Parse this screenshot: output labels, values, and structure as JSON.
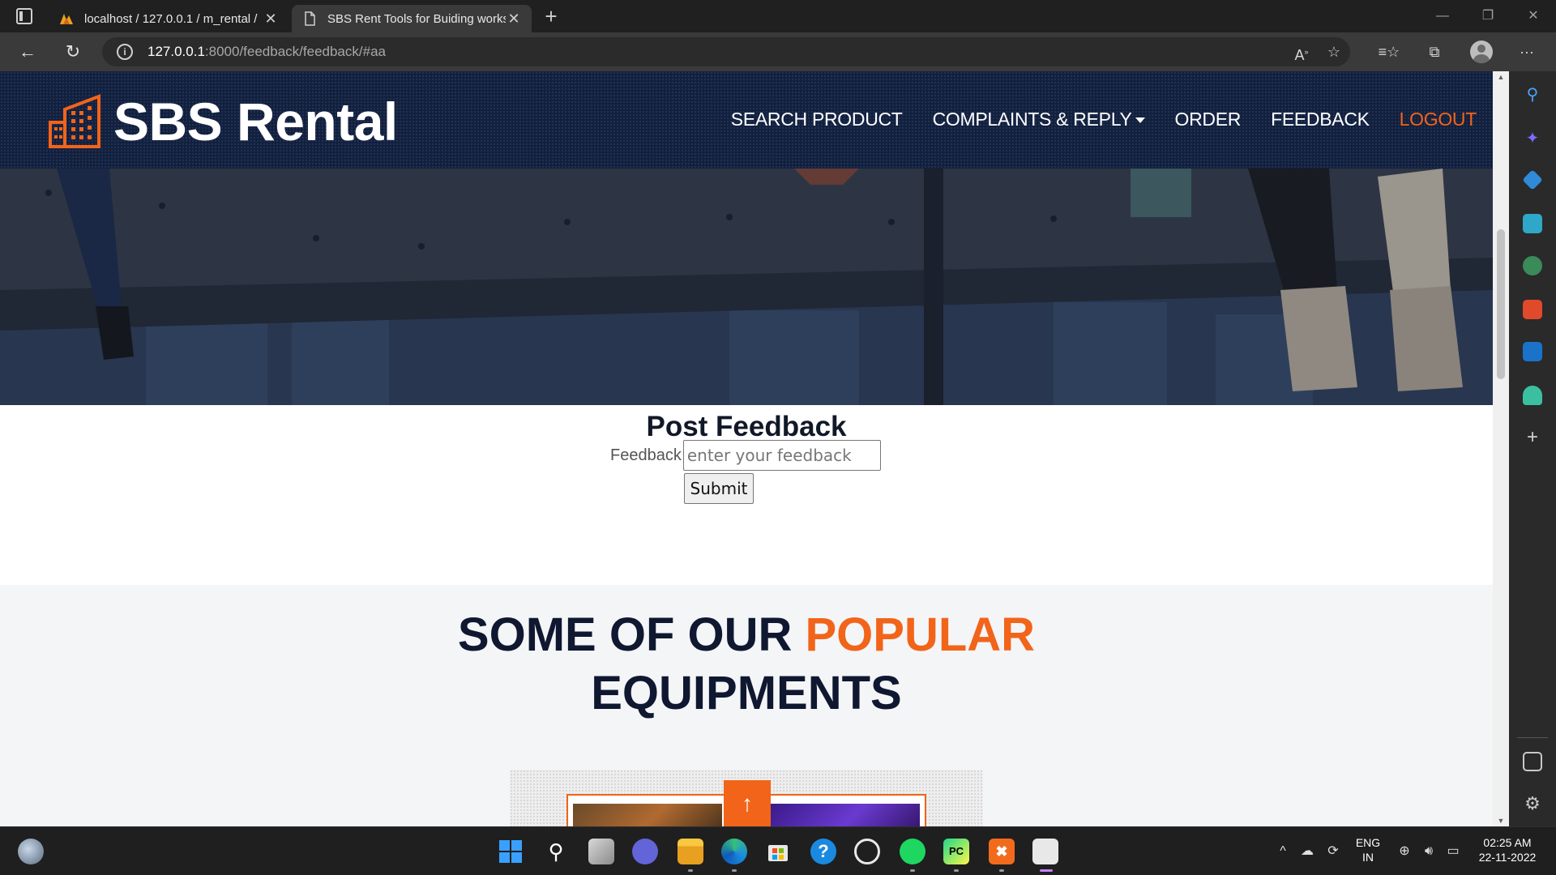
{
  "browser": {
    "tabs": [
      {
        "title": "localhost / 127.0.0.1 / m_rental /"
      },
      {
        "title": "SBS Rent Tools for Buiding works"
      }
    ],
    "url_host": "127.0.0.1",
    "url_path": ":8000/feedback/feedback/#aa"
  },
  "site": {
    "logo_text": "SBS Rental",
    "menu": {
      "search": "SEARCH PRODUCT",
      "complaints": "COMPLAINTS & REPLY",
      "order": "ORDER",
      "feedback": "FEEDBACK",
      "logout": "LOGOUT"
    },
    "accent_color": "#f26419",
    "header_color": "#122040"
  },
  "feedback_form": {
    "title": "Post Feedback",
    "label": "Feedback",
    "placeholder": "enter your feedback",
    "submit": "Submit"
  },
  "equipments": {
    "heading_part1": "SOME OF OUR ",
    "heading_accent": "POPULAR",
    "heading_part2": "EQUIPMENTS"
  },
  "taskbar": {
    "language": "ENG",
    "region": "IN",
    "time": "02:25 AM",
    "date": "22-11-2022"
  }
}
